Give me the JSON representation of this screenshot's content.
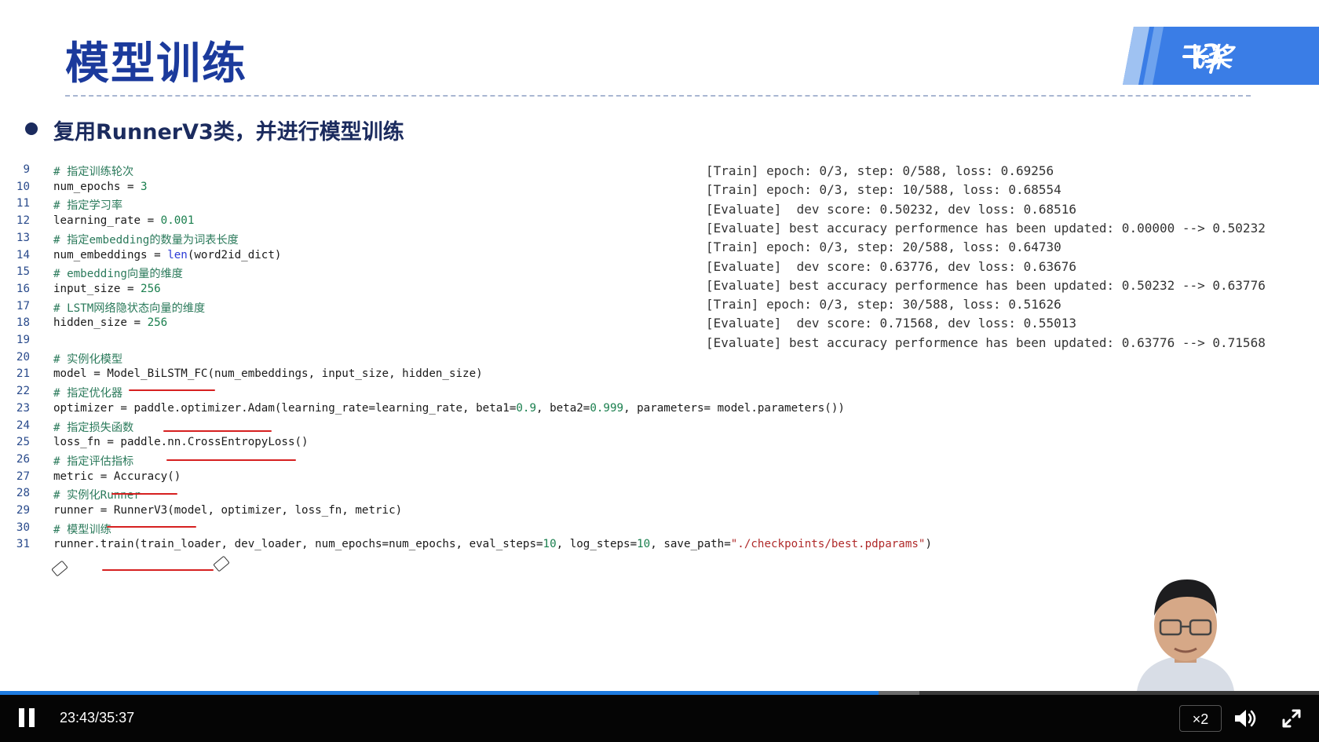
{
  "slide": {
    "title": "模型训练",
    "bullet": "复用RunnerV3类，并进行模型训练",
    "logo_text": "飞桨"
  },
  "code": [
    {
      "ln": "9",
      "parts": [
        {
          "c": "cm",
          "t": "# 指定训练轮次"
        }
      ]
    },
    {
      "ln": "10",
      "parts": [
        {
          "c": "",
          "t": "num_epochs = "
        },
        {
          "c": "num",
          "t": "3"
        }
      ]
    },
    {
      "ln": "11",
      "parts": [
        {
          "c": "cm",
          "t": "# 指定学习率"
        }
      ]
    },
    {
      "ln": "12",
      "parts": [
        {
          "c": "",
          "t": "learning_rate = "
        },
        {
          "c": "num",
          "t": "0.001"
        }
      ]
    },
    {
      "ln": "13",
      "parts": [
        {
          "c": "cm",
          "t": "# 指定embedding的数量为词表长度"
        }
      ]
    },
    {
      "ln": "14",
      "parts": [
        {
          "c": "",
          "t": "num_embeddings = "
        },
        {
          "c": "fn",
          "t": "len"
        },
        {
          "c": "",
          "t": "(word2id_dict)"
        }
      ]
    },
    {
      "ln": "15",
      "parts": [
        {
          "c": "cm",
          "t": "# embedding向量的维度"
        }
      ]
    },
    {
      "ln": "16",
      "parts": [
        {
          "c": "",
          "t": "input_size = "
        },
        {
          "c": "num",
          "t": "256"
        }
      ]
    },
    {
      "ln": "17",
      "parts": [
        {
          "c": "cm",
          "t": "# LSTM网络隐状态向量的维度"
        }
      ]
    },
    {
      "ln": "18",
      "parts": [
        {
          "c": "",
          "t": "hidden_size = "
        },
        {
          "c": "num",
          "t": "256"
        }
      ]
    },
    {
      "ln": "19",
      "parts": []
    },
    {
      "ln": "20",
      "parts": [
        {
          "c": "cm",
          "t": "# 实例化模型"
        }
      ]
    },
    {
      "ln": "21",
      "parts": [
        {
          "c": "",
          "t": "model = Model_BiLSTM_FC(num_embeddings, input_size, hidden_size)"
        }
      ]
    },
    {
      "ln": "22",
      "parts": [
        {
          "c": "cm",
          "t": "# 指定优化器"
        }
      ]
    },
    {
      "ln": "23",
      "parts": [
        {
          "c": "",
          "t": "optimizer = paddle.optimizer.Adam(learning_rate=learning_rate, beta1="
        },
        {
          "c": "num",
          "t": "0.9"
        },
        {
          "c": "",
          "t": ", beta2="
        },
        {
          "c": "num",
          "t": "0.999"
        },
        {
          "c": "",
          "t": ", parameters= model.parameters())"
        }
      ]
    },
    {
      "ln": "24",
      "parts": [
        {
          "c": "cm",
          "t": "# 指定损失函数"
        }
      ]
    },
    {
      "ln": "25",
      "parts": [
        {
          "c": "",
          "t": "loss_fn = paddle.nn.CrossEntropyLoss()"
        }
      ]
    },
    {
      "ln": "26",
      "parts": [
        {
          "c": "cm",
          "t": "# 指定评估指标"
        }
      ]
    },
    {
      "ln": "27",
      "parts": [
        {
          "c": "",
          "t": "metric = Accuracy()"
        }
      ]
    },
    {
      "ln": "28",
      "parts": [
        {
          "c": "cm",
          "t": "# 实例化Runner"
        }
      ]
    },
    {
      "ln": "29",
      "parts": [
        {
          "c": "",
          "t": "runner = RunnerV3(model, optimizer, loss_fn, metric)"
        }
      ]
    },
    {
      "ln": "30",
      "parts": [
        {
          "c": "cm",
          "t": "# 模型训练"
        }
      ]
    },
    {
      "ln": "31",
      "parts": [
        {
          "c": "",
          "t": "runner.train(train_loader, dev_loader, num_epochs=num_epochs, eval_steps="
        },
        {
          "c": "num",
          "t": "10"
        },
        {
          "c": "",
          "t": ", log_steps="
        },
        {
          "c": "num",
          "t": "10"
        },
        {
          "c": "",
          "t": ", save_path="
        },
        {
          "c": "str",
          "t": "\"./checkpoints/best.pdparams\""
        },
        {
          "c": "",
          "t": ")"
        }
      ]
    }
  ],
  "output": [
    "[Train] epoch: 0/3, step: 0/588, loss: 0.69256",
    "[Train] epoch: 0/3, step: 10/588, loss: 0.68554",
    "[Evaluate]  dev score: 0.50232, dev loss: 0.68516",
    "[Evaluate] best accuracy performence has been updated: 0.00000 --> 0.50232",
    "[Train] epoch: 0/3, step: 20/588, loss: 0.64730",
    "[Evaluate]  dev score: 0.63776, dev loss: 0.63676",
    "[Evaluate] best accuracy performence has been updated: 0.50232 --> 0.63776",
    "[Train] epoch: 0/3, step: 30/588, loss: 0.51626",
    "[Evaluate]  dev score: 0.71568, dev loss: 0.55013",
    "[Evaluate] best accuracy performence has been updated: 0.63776 --> 0.71568"
  ],
  "player": {
    "current_time": "23:43",
    "separator": "/",
    "total_time": "35:37",
    "speed_label": "×2",
    "progress_fraction": 0.666,
    "buffered_fraction": 0.697,
    "accent_color": "#1e7be0",
    "icons": {
      "play": "pause-icon",
      "volume": "volume-icon",
      "fullscreen": "fullscreen-icon"
    }
  }
}
